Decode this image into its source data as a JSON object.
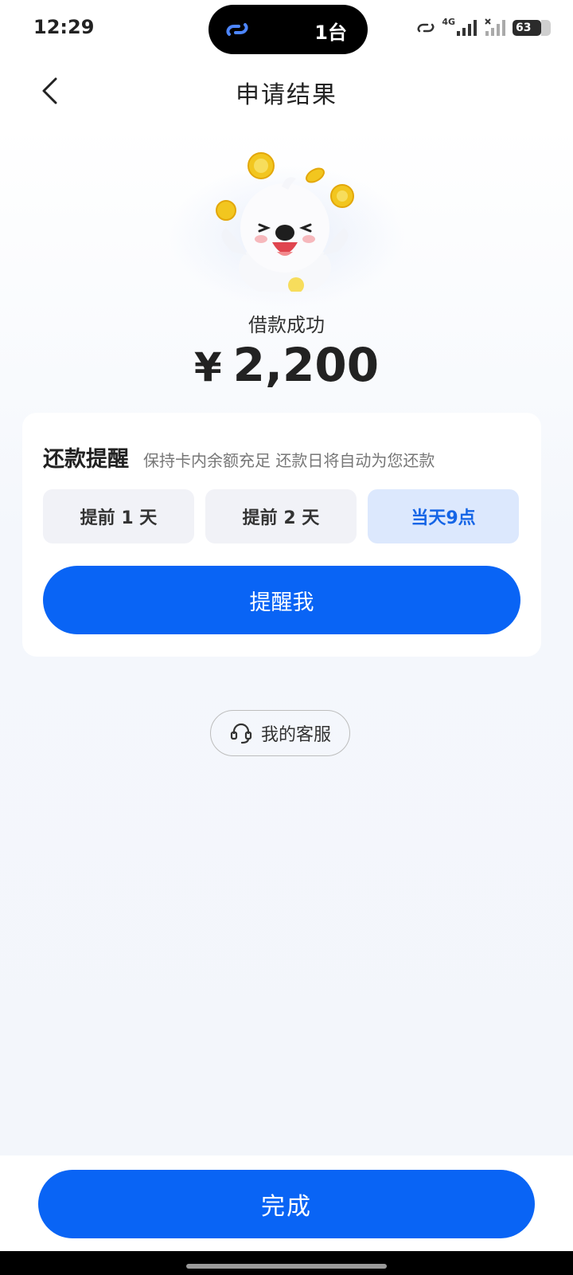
{
  "status_bar": {
    "time": "12:29",
    "island_text": "1台",
    "network_label": "4G",
    "battery": "63"
  },
  "nav": {
    "title": "申请结果"
  },
  "result": {
    "label": "借款成功",
    "currency": "¥",
    "amount": "2,200"
  },
  "reminder": {
    "title": "还款提醒",
    "subtitle": "保持卡内余额充足 还款日将自动为您还款",
    "options": [
      "提前 1 天",
      "提前 2 天",
      "当天9点"
    ],
    "selected_index": 2,
    "button_label": "提醒我"
  },
  "service": {
    "label": "我的客服"
  },
  "footer": {
    "done_label": "完成"
  },
  "colors": {
    "primary": "#0964f5",
    "selected_bg": "#dce8fd",
    "selected_text": "#1565e6"
  },
  "icons": [
    "link-icon",
    "signal-icon",
    "battery-icon",
    "back-arrow-icon",
    "mascot-illustration",
    "headset-icon"
  ]
}
